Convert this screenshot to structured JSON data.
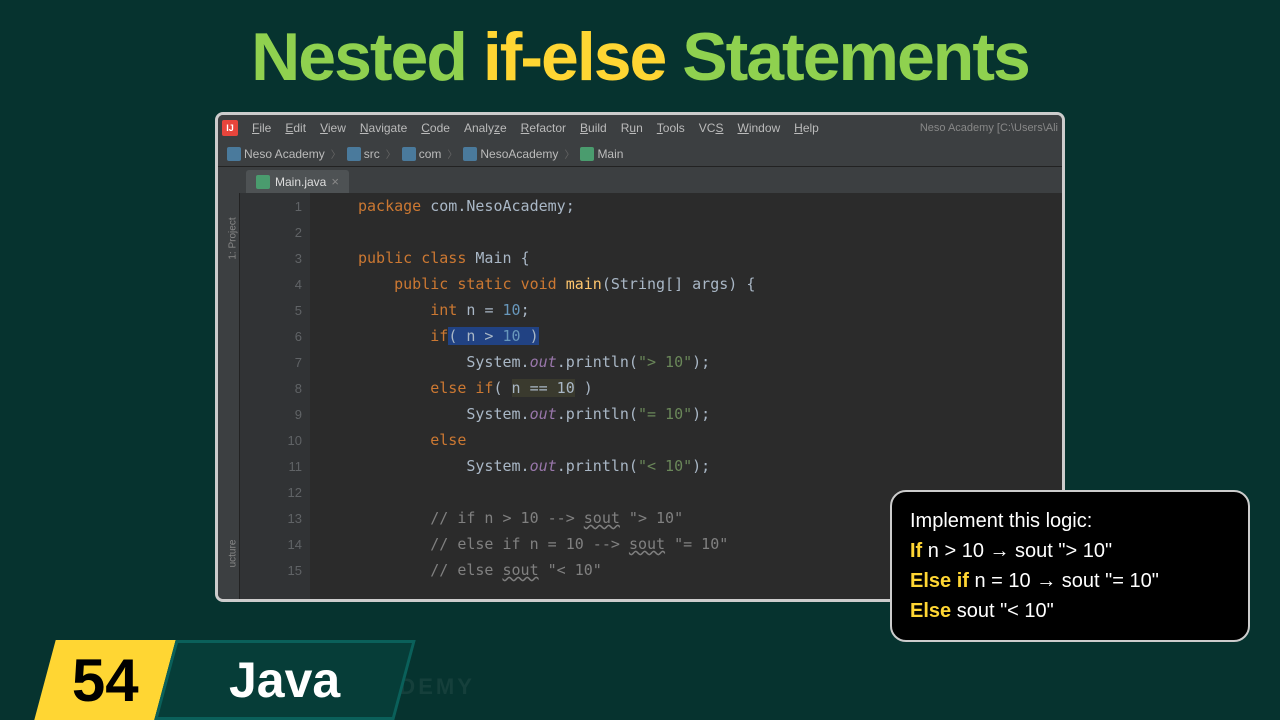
{
  "heading": {
    "pre": "Nested ",
    "accent": "if-else",
    "post": " Statements"
  },
  "menu": {
    "items": [
      "File",
      "Edit",
      "View",
      "Navigate",
      "Code",
      "Analyze",
      "Refactor",
      "Build",
      "Run",
      "Tools",
      "VCS",
      "Window",
      "Help"
    ],
    "right": "Neso Academy [C:\\Users\\Ali"
  },
  "breadcrumbs": [
    {
      "label": "Neso Academy",
      "icon": "folder"
    },
    {
      "label": "src",
      "icon": "folder"
    },
    {
      "label": "com",
      "icon": "pkg"
    },
    {
      "label": "NesoAcademy",
      "icon": "pkg"
    },
    {
      "label": "Main",
      "icon": "cls"
    }
  ],
  "tab": {
    "icon": "cls",
    "label": "Main.java"
  },
  "sidebar": {
    "top": "1: Project",
    "bottom": "ucture"
  },
  "gutter": {
    "lines": [
      "1",
      "2",
      "3",
      "4",
      "5",
      "6",
      "7",
      "8",
      "9",
      "10",
      "11",
      "12",
      "13",
      "14",
      "15"
    ],
    "run_lines": [
      3,
      4
    ],
    "bulb_line": 6
  },
  "code": {
    "l1": {
      "a": "package ",
      "b": "com.NesoAcademy",
      "c": ";"
    },
    "l3": {
      "a": "public class ",
      "b": "Main ",
      "c": "{"
    },
    "l4": {
      "a": "    public static ",
      "b": "void ",
      "c": "main",
      "d": "(String[] args) {"
    },
    "l5": {
      "a": "        int ",
      "b": "n ",
      "c": "= ",
      "d": "10",
      "e": ";"
    },
    "l6": {
      "a": "        if",
      "b": "( n > ",
      "c": "10 ",
      "d": ")"
    },
    "l7": {
      "a": "            System.",
      "b": "out",
      "c": ".println(",
      "d": "\"> 10\"",
      "e": ");"
    },
    "l8": {
      "a": "        else if",
      "b": "( ",
      "c": "n == 10",
      "d": " )"
    },
    "l9": {
      "a": "            System.",
      "b": "out",
      "c": ".println(",
      "d": "\"= 10\"",
      "e": ");"
    },
    "l10": {
      "a": "        else"
    },
    "l11": {
      "a": "            System.",
      "b": "out",
      "c": ".println(",
      "d": "\"< 10\"",
      "e": ");"
    },
    "l13": {
      "a": "        // if n > 10 --> ",
      "b": "sout",
      "c": " \"> 10\""
    },
    "l14": {
      "a": "        // else if n = 10 --> ",
      "b": "sout",
      "c": " \"= 10\""
    },
    "l15": {
      "a": "        // else ",
      "b": "sout",
      "c": " \"< 10\""
    }
  },
  "sidebox": {
    "title": "Implement this logic:",
    "r1": {
      "k": "If",
      "t": " n > 10 → sout \"> 10\""
    },
    "r2": {
      "k": "Else if",
      "t": " n = 10 → sout \"= 10\""
    },
    "r3": {
      "k": "Else",
      "t": " sout \"< 10\""
    }
  },
  "footer": {
    "num": "54",
    "lang": "Java"
  },
  "watermark": "NESO ACADEMY"
}
